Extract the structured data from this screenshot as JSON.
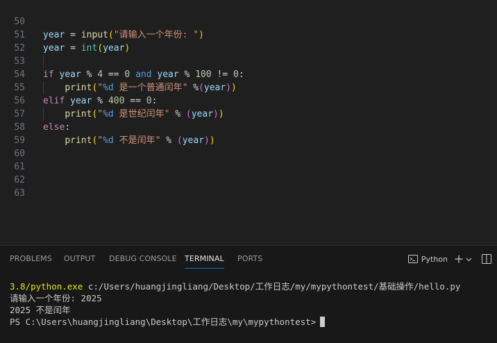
{
  "editor": {
    "lines": [
      {
        "num": "50"
      },
      {
        "num": "51"
      },
      {
        "num": "52"
      },
      {
        "num": "53"
      },
      {
        "num": "54"
      },
      {
        "num": "55"
      },
      {
        "num": "56"
      },
      {
        "num": "57"
      },
      {
        "num": "58"
      },
      {
        "num": "59"
      },
      {
        "num": "60"
      },
      {
        "num": "61"
      },
      {
        "num": "62"
      },
      {
        "num": "63"
      }
    ],
    "code": {
      "l50_str": "\"请输入一个年份: \"",
      "l54_str1": "\"",
      "l54_fmt": "%d",
      "l54_str2": " 是一个普通闰年\"",
      "l56_str2": " 是世纪闰年\"",
      "l58_str2": " 不是闰年\""
    }
  },
  "panel": {
    "tabs": [
      {
        "label": "PROBLEMS"
      },
      {
        "label": "OUTPUT"
      },
      {
        "label": "DEBUG CONSOLE"
      },
      {
        "label": "TERMINAL"
      },
      {
        "label": "PORTS"
      }
    ],
    "active_tab": "TERMINAL",
    "terminal_name": "Python",
    "terminal_lines": {
      "line1_yellow": "3.8/python.exe",
      "line1_rest": " c:/Users/huangjingliang/Desktop/工作日志/my/mypythontest/基础操作/hello.py",
      "line2": "请输入一个年份: 2025",
      "line3": "2025 不是闰年",
      "line4": "PS C:\\Users\\huangjingliang\\Desktop\\工作日志\\my\\mypythontest>"
    }
  },
  "colors": {
    "editor_bg": "#1f1f1f",
    "panel_bg": "#181818",
    "accent": "#0078d4"
  }
}
